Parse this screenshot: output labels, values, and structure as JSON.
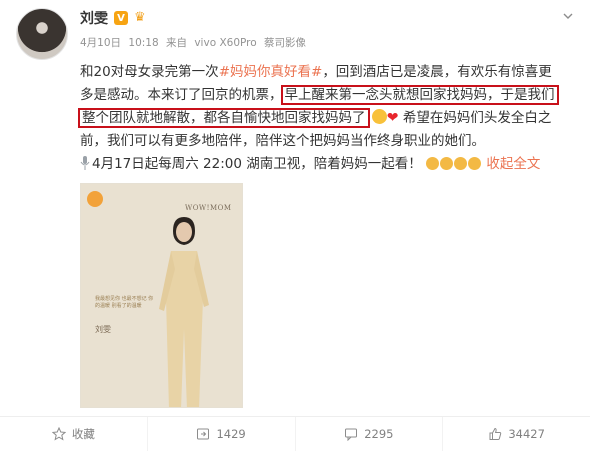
{
  "post": {
    "author": "刘雯",
    "verified_badge": "V",
    "meta": {
      "date": "4月10日",
      "time": "10:18",
      "source_prefix": "来自",
      "device": "vivo X60Pro",
      "device_suffix": "蔡司影像"
    },
    "text": {
      "l1_a": "和20对母女录完第一次",
      "hashtag": "#妈妈你真好看#",
      "l1_b": "，回到酒店已是凌晨，有欢乐有惊喜更",
      "l2_a": "多是感动。本来订了回京的机票，",
      "l2_hl": "早上醒来第一念头就想回家找妈妈，于是我们",
      "l3_hl": "整个团队就地解散，都各自愉快地回家找妈妈了",
      "l3_b": "希望在妈妈们头发全白之",
      "l4": "前，我们可以有更多地陪伴，陪伴这个把妈妈当作终身职业的她们。",
      "l5_a": "4月17日起每周六 22:00 湖南卫视，陪着妈妈一起看！",
      "fold": "收起全文"
    },
    "poster": {
      "brand": "WOW!MOM",
      "caption": "我最想见你 也最不想记 你的温暖 别看了的温暖",
      "name": "刘雯"
    }
  },
  "actions": {
    "favorite_label": "收藏",
    "repost_count": "1429",
    "comment_count": "2295",
    "like_count": "34427"
  },
  "colors": {
    "accent": "#eb7350",
    "highlight_box": "#c8101a",
    "muted": "#939393"
  }
}
